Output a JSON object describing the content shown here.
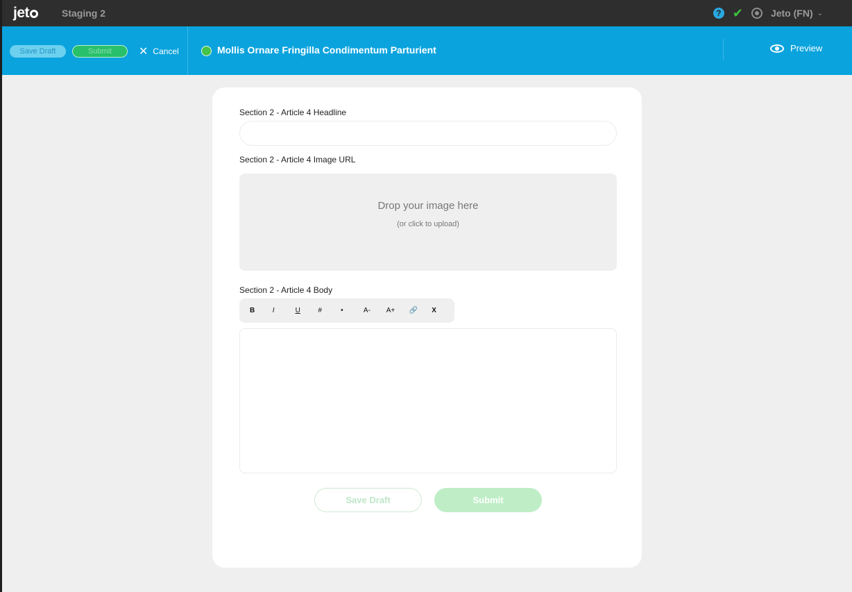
{
  "topbar": {
    "logo": "jet",
    "environment": "Staging 2",
    "user_menu": "Jeto (FN)",
    "icons": [
      "help-icon",
      "check-icon",
      "gear-icon",
      "chevron-down-icon"
    ]
  },
  "toolbar": {
    "save_draft_label": "Save Draft",
    "submit_label": "Submit",
    "cancel_label": "Cancel",
    "document_title": "Mollis Ornare Fringilla Condimentum Parturient",
    "status_color": "#45c34a",
    "preview_label": "Preview",
    "accent_color": "#0aa3dd"
  },
  "form": {
    "headline_label": "Section 2 - Article 4 Headline",
    "headline_value": "",
    "image_label": "Section 2 - Article 4 Image URL",
    "dropzone_main": "Drop your image here",
    "dropzone_sub": "(or click to upload)",
    "body_label": "Section 2 - Article 4 Body",
    "rte_buttons": [
      "B",
      "I",
      "U",
      "#",
      "•",
      "A-",
      "A+",
      "🔗",
      "X"
    ],
    "save_draft_label": "Save Draft",
    "submit_label": "Submit"
  }
}
